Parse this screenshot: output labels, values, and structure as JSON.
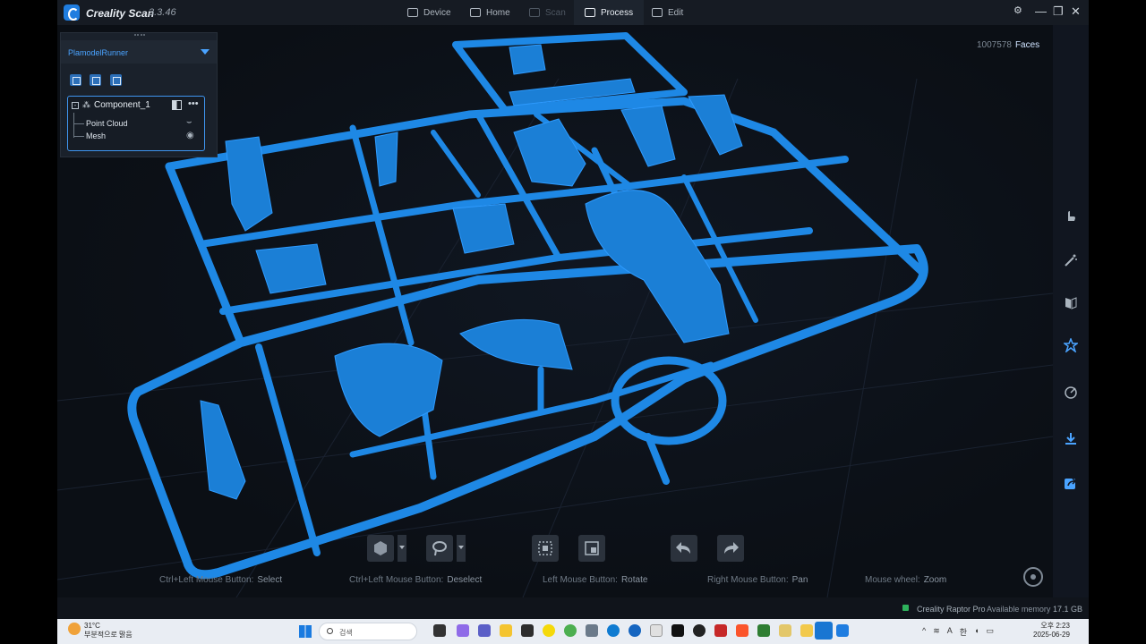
{
  "app": {
    "name": "Creality Scan",
    "version": "3.3.46"
  },
  "nav": {
    "device": "Device",
    "home": "Home",
    "scan": "Scan",
    "process": "Process",
    "edit": "Edit"
  },
  "viewport": {
    "face_count": "1007578",
    "face_label": "Faces"
  },
  "panel": {
    "project": "PlamodelRunner",
    "component": "Component_1",
    "children": [
      "Point Cloud",
      "Mesh"
    ]
  },
  "hints": [
    {
      "keys": "Ctrl+Left Mouse Button:",
      "action": "Select"
    },
    {
      "keys": "Ctrl+Left Mouse Button:",
      "action": "Deselect"
    },
    {
      "keys": "Left Mouse Button:",
      "action": "Rotate"
    },
    {
      "keys": "Right Mouse Button:",
      "action": "Pan"
    },
    {
      "keys": "Mouse wheel:",
      "action": "Zoom"
    }
  ],
  "status": {
    "device": "Creality Raptor Pro",
    "memory_label": "Available memory",
    "memory_value": "17.1 GB"
  },
  "taskbar": {
    "weather_temp": "31°C",
    "weather_desc": "부분적으로 맑음",
    "search_placeholder": "검색",
    "time": "오후 2:23",
    "date": "2025-06-29",
    "ime": "한",
    "font_a": "A"
  },
  "colors": {
    "accent": "#1f7de0",
    "mesh": "#1e88e5",
    "active_border": "#3f95ef"
  }
}
